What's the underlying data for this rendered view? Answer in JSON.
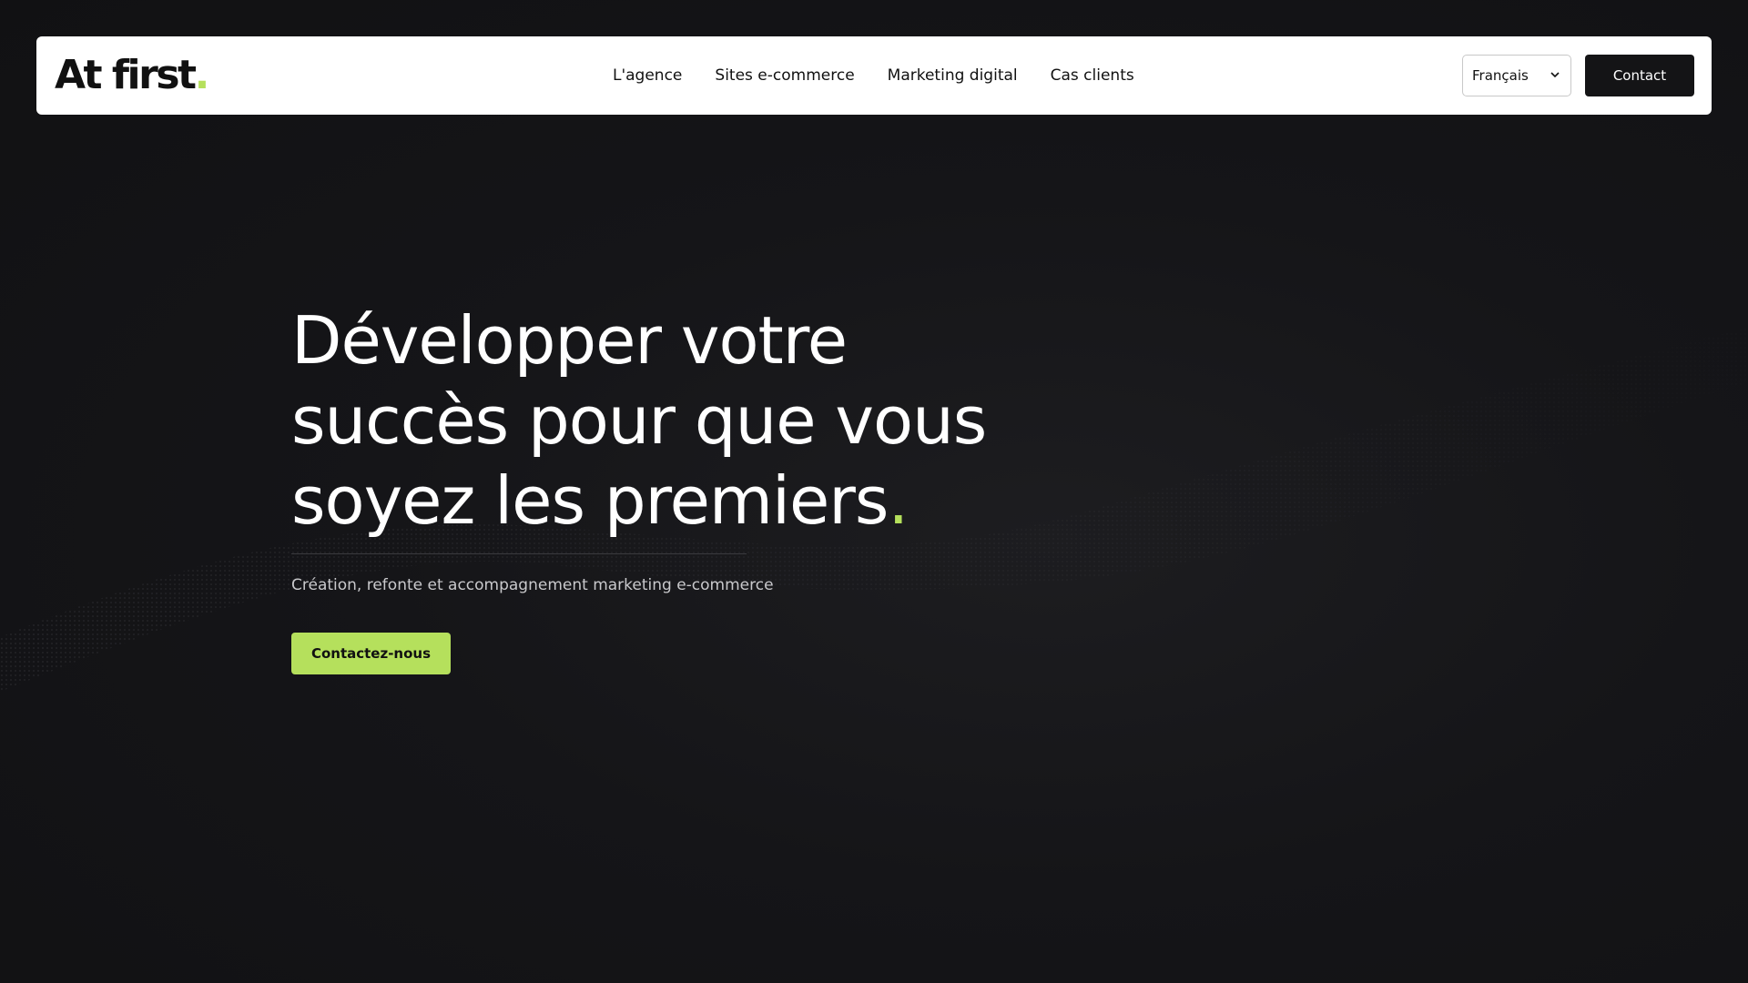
{
  "header": {
    "logo_text": "At first",
    "logo_dot": ".",
    "nav": [
      {
        "label": "L'agence"
      },
      {
        "label": "Sites e-commerce"
      },
      {
        "label": "Marketing digital"
      },
      {
        "label": "Cas clients"
      }
    ],
    "language": {
      "selected": "Français"
    },
    "contact_label": "Contact"
  },
  "hero": {
    "title_line1": "Développer votre",
    "title_line2": "succès pour que vous",
    "title_line3": "soyez les premiers",
    "title_dot": ".",
    "subtitle": "Création, refonte et accompagnement marketing e-commerce",
    "cta_label": "Contactez-nous"
  },
  "icons": {
    "language_chevron": "chevron-down-icon"
  },
  "colors": {
    "accent": "#b5e05c",
    "background": "#121215",
    "navbar": "#ffffff",
    "dark_button": "#141416",
    "text_light": "#ffffff",
    "text_muted": "#c9c9cc"
  }
}
